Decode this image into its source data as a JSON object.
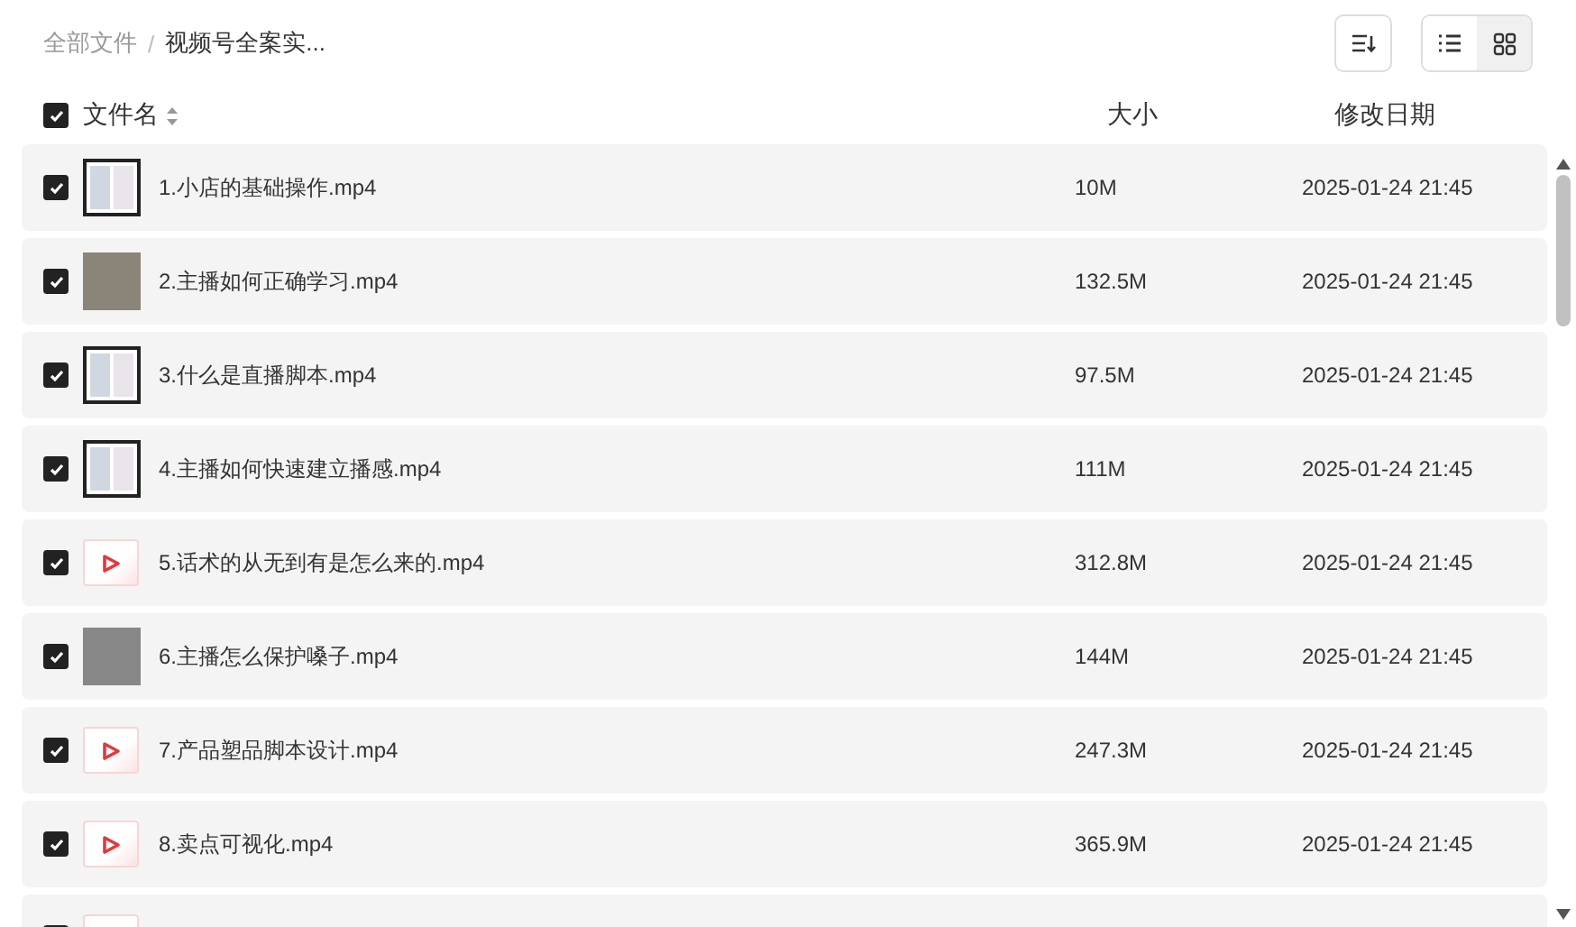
{
  "breadcrumb": [
    {
      "label": "全部文件"
    },
    {
      "separator": "/",
      "label": "视频号全案实..."
    }
  ],
  "view_toggle": [
    {
      "kind": "list",
      "selected": false
    },
    {
      "kind": "grid",
      "selected": true
    }
  ],
  "header": {
    "checked": true,
    "name": "文件名",
    "size": "大小",
    "date": "修改日期"
  },
  "rows": [
    {
      "checked": true,
      "kind": "screenshot",
      "name": "1.小店的基础操作.mp4",
      "size": "10M",
      "date": "2025-01-24 21:45"
    },
    {
      "checked": true,
      "kind": "photo",
      "name": "2.主播如何正确学习.mp4",
      "size": "132.5M",
      "date": "2025-01-24 21:45"
    },
    {
      "checked": true,
      "kind": "screenshot",
      "name": "3.什么是直播脚本.mp4",
      "size": "97.5M",
      "date": "2025-01-24 21:45"
    },
    {
      "checked": true,
      "kind": "screenshot",
      "name": "4.主播如何快速建立播感.mp4",
      "size": "111M",
      "date": "2025-01-24 21:45"
    },
    {
      "checked": true,
      "kind": "video",
      "name": "5.话术的从无到有是怎么来的.mp4",
      "size": "312.8M",
      "date": "2025-01-24 21:45"
    },
    {
      "checked": true,
      "kind": "blank",
      "name": "6.主播怎么保护嗓子.mp4",
      "size": "144M",
      "date": "2025-01-24 21:45"
    },
    {
      "checked": true,
      "kind": "video",
      "name": "7.产品塑品脚本设计.mp4",
      "size": "247.3M",
      "date": "2025-01-24 21:45"
    },
    {
      "checked": true,
      "kind": "video",
      "name": "8.卖点可视化.mp4",
      "size": "365.9M",
      "date": "2025-01-24 21:45"
    },
    {
      "checked": true,
      "kind": "video"
    }
  ]
}
